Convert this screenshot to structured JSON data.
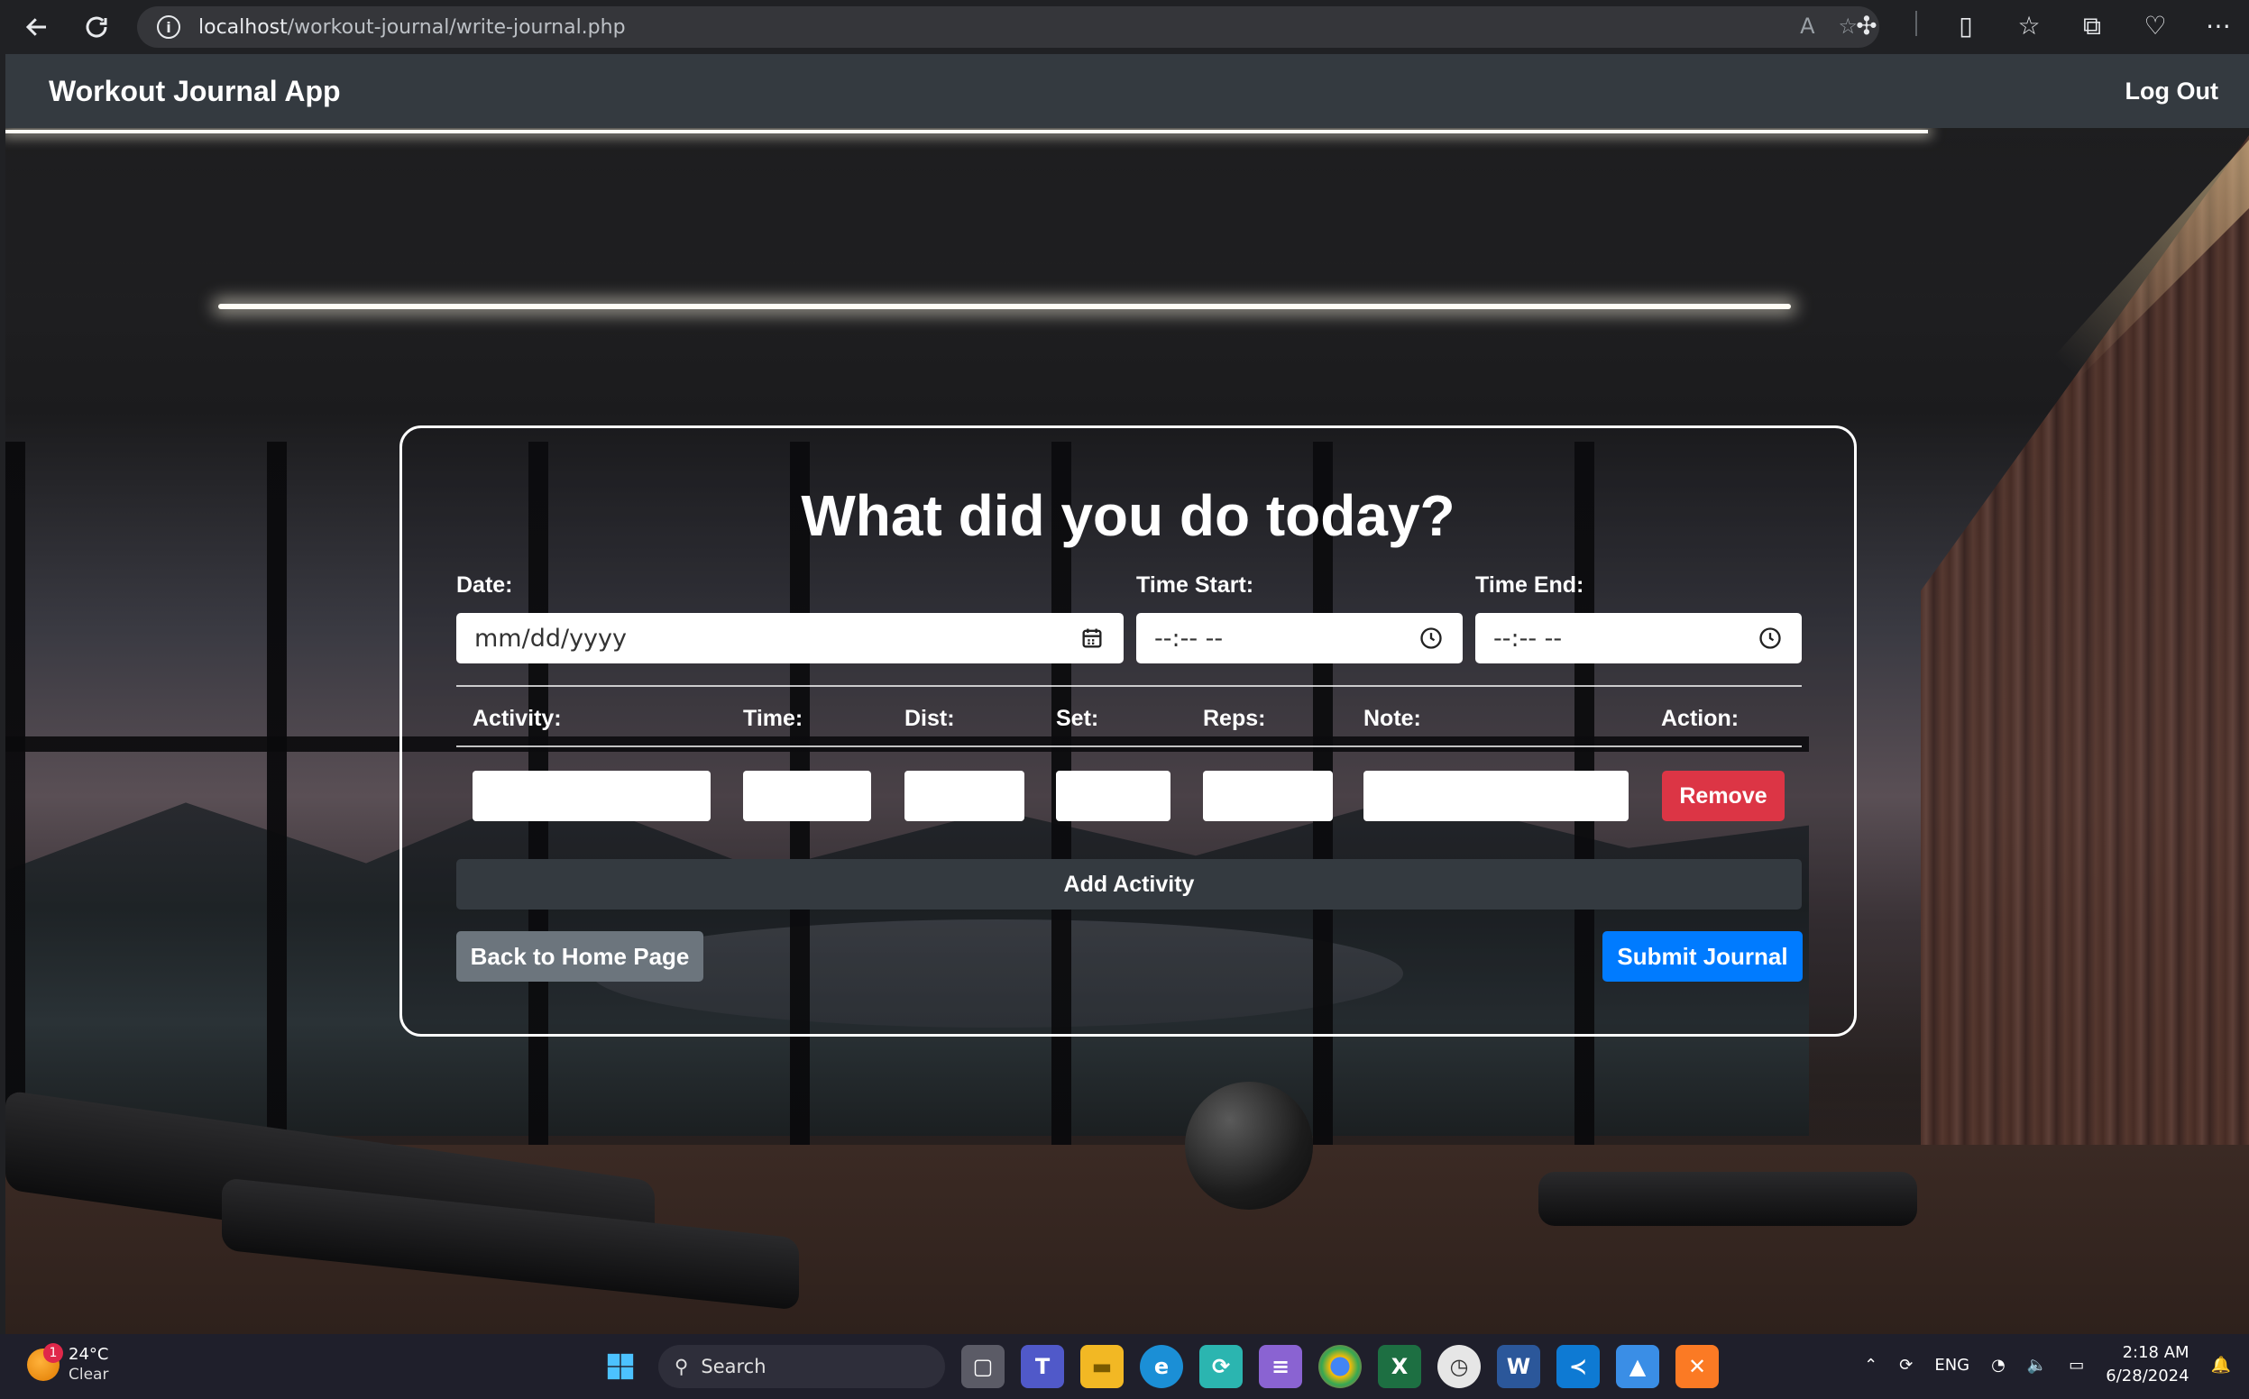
{
  "browser": {
    "url_host": "localhost",
    "url_path": "/workout-journal/write-journal.php"
  },
  "navbar": {
    "brand": "Workout Journal App",
    "logout_label": "Log Out"
  },
  "form": {
    "title": "What did you do today?",
    "date_label": "Date:",
    "date_placeholder": "mm/dd/yyyy",
    "time_start_label": "Time Start:",
    "time_start_placeholder": "--:-- --",
    "time_end_label": "Time End:",
    "time_end_placeholder": "--:-- --",
    "columns": [
      "Activity:",
      "Time:",
      "Dist:",
      "Set:",
      "Reps:",
      "Note:",
      "Action:"
    ],
    "remove_label": "Remove",
    "add_activity_label": "Add Activity",
    "back_label": "Back to Home Page",
    "submit_label": "Submit Journal"
  },
  "taskbar": {
    "weather_temp": "24°C",
    "weather_condition": "Clear",
    "weather_badge": "1",
    "search_label": "Search",
    "language": "ENG",
    "time": "2:18 AM",
    "date": "6/28/2024"
  },
  "colors": {
    "navbar_bg": "#343a40",
    "remove_btn": "#dc3545",
    "add_btn": "#343a40",
    "back_btn": "#6c757d",
    "submit_btn": "#007bff"
  }
}
